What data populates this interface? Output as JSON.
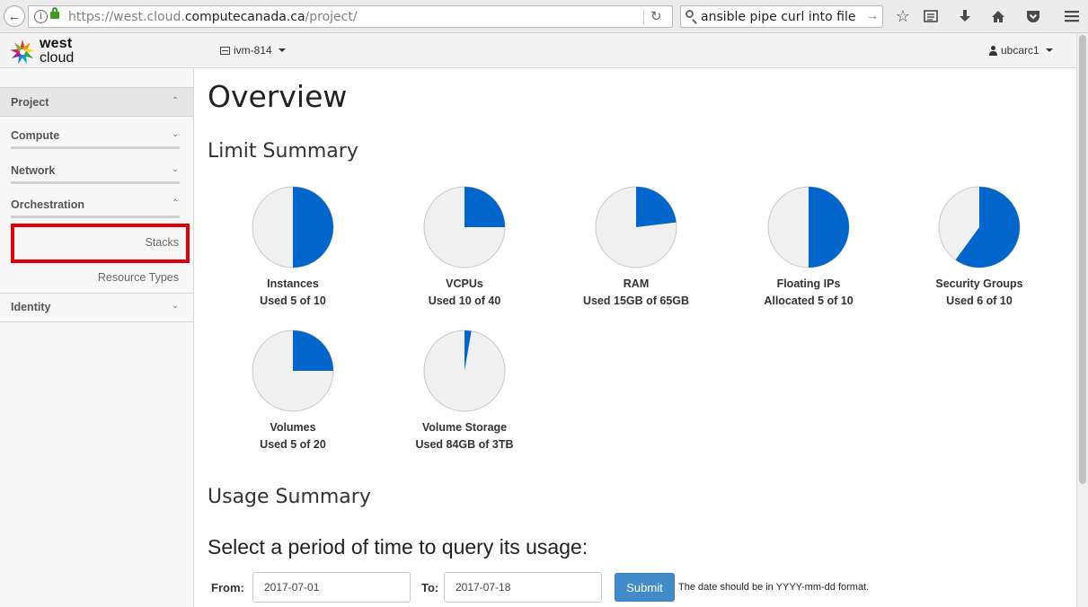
{
  "browser": {
    "url_prefix": "https://west.cloud.",
    "url_domain": "computecanada.ca",
    "url_path": "/project/",
    "search_query": "ansible pipe curl into file"
  },
  "topnav": {
    "logo_top": "west",
    "logo_bottom": "cloud",
    "project_name": "ivm-814",
    "user_name": "ubcarc1"
  },
  "sidebar": {
    "project_label": "Project",
    "sections": [
      {
        "label": "Compute"
      },
      {
        "label": "Network"
      },
      {
        "label": "Orchestration"
      }
    ],
    "orchestration_items": [
      "Stacks",
      "Resource Types"
    ],
    "identity_label": "Identity"
  },
  "main": {
    "title": "Overview",
    "limit_summary": "Limit Summary",
    "usage_summary": "Usage Summary",
    "query_title": "Select a period of time to query its usage:",
    "from_label": "From:",
    "to_label": "To:",
    "from_value": "2017-07-01",
    "to_value": "2017-07-18",
    "submit_label": "Submit",
    "help_text": "The date should be in YYYY-mm-dd format."
  },
  "colors": {
    "pie_used": "#0066cc",
    "pie_free": "#f0f0f0",
    "pie_stroke": "#c9c9c9",
    "highlight": "#e0000a"
  },
  "limits": [
    {
      "name": "Instances",
      "usage_text": "Used 5 of 10",
      "fraction": 0.5
    },
    {
      "name": "VCPUs",
      "usage_text": "Used 10 of 40",
      "fraction": 0.25
    },
    {
      "name": "RAM",
      "usage_text": "Used 15GB of 65GB",
      "fraction": 0.2308
    },
    {
      "name": "Floating IPs",
      "usage_text": "Allocated 5 of 10",
      "fraction": 0.5
    },
    {
      "name": "Security Groups",
      "usage_text": "Used 6 of 10",
      "fraction": 0.6
    },
    {
      "name": "Volumes",
      "usage_text": "Used 5 of 20",
      "fraction": 0.25
    },
    {
      "name": "Volume Storage",
      "usage_text": "Used 84GB of 3TB",
      "fraction": 0.0273
    }
  ]
}
